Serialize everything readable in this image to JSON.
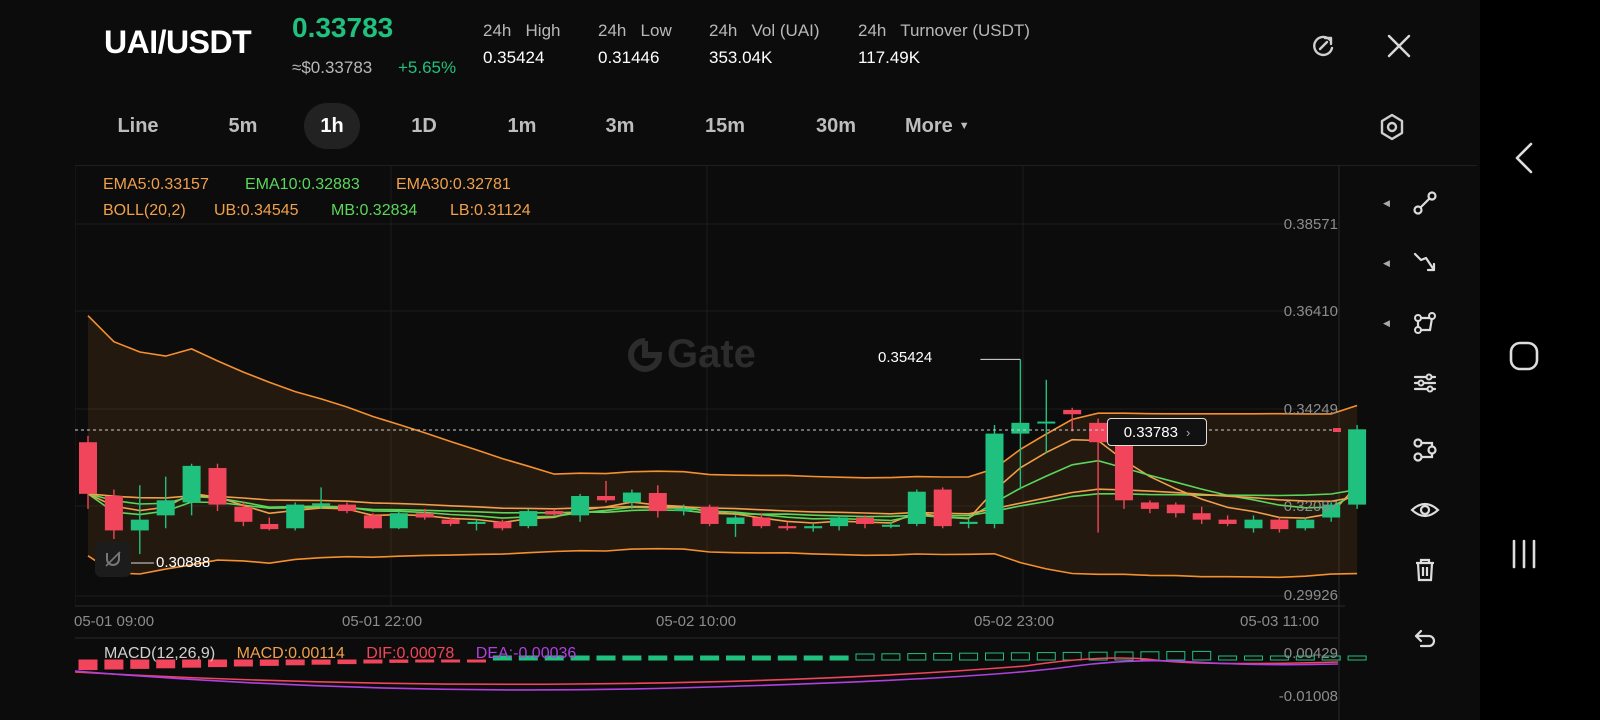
{
  "header": {
    "pair": "UAI/USDT",
    "price": "0.33783",
    "usd_price": "≈$0.33783",
    "change": "+5.65%",
    "stats": [
      {
        "label": "24h   High",
        "value": "0.35424"
      },
      {
        "label": "24h   Low",
        "value": "0.31446"
      },
      {
        "label": "24h   Vol (UAI)",
        "value": "353.04K"
      },
      {
        "label": "24h   Turnover (USDT)",
        "value": "117.49K"
      }
    ]
  },
  "tabs": [
    "Line",
    "5m",
    "1h",
    "1D",
    "1m",
    "3m",
    "15m",
    "30m",
    "More"
  ],
  "active_tab": "1h",
  "legend": {
    "ema5": "EMA5:0.33157",
    "ema10": "EMA10:0.32883",
    "ema30": "EMA30:0.32781",
    "boll": "BOLL(20,2)",
    "ub": "UB:0.34545",
    "mb": "MB:0.32834",
    "lb": "LB:0.31124"
  },
  "y_ticks": [
    "0.38571",
    "0.36410",
    "0.34249",
    "0.32087",
    "0.29926"
  ],
  "x_ticks": [
    "05-01 09:00",
    "05-01 22:00",
    "05-02 10:00",
    "05-02 23:00",
    "05-03 11:00"
  ],
  "annotations": {
    "high_marker": "0.35424",
    "low_marker": "0.30888",
    "current_price": "0.33783"
  },
  "watermark": "Gate",
  "macd": {
    "label": "MACD(12,26,9)",
    "macd": "MACD:0.00114",
    "dif": "DIF:0.00078",
    "dea": "DEA:-0.00036",
    "y_top": "0.00429",
    "y_bottom": "-0.01008"
  },
  "colors": {
    "up": "#20c17e",
    "down": "#f0455b",
    "ema5": "#f0a04b",
    "ema10": "#5bd65b",
    "ema30": "#f0a04b",
    "boll": "#f5902f",
    "dif": "#f0455b",
    "dea": "#b040e0"
  },
  "chart_data": {
    "type": "candlestick",
    "ylim": [
      0.29926,
      0.38571
    ],
    "candles": [
      {
        "o": 0.335,
        "h": 0.3365,
        "l": 0.3195,
        "c": 0.323
      },
      {
        "o": 0.3225,
        "h": 0.324,
        "l": 0.3125,
        "c": 0.3145
      },
      {
        "o": 0.3145,
        "h": 0.325,
        "l": 0.309,
        "c": 0.317
      },
      {
        "o": 0.318,
        "h": 0.327,
        "l": 0.315,
        "c": 0.3215
      },
      {
        "o": 0.321,
        "h": 0.33,
        "l": 0.318,
        "c": 0.3295
      },
      {
        "o": 0.329,
        "h": 0.33,
        "l": 0.319,
        "c": 0.3205
      },
      {
        "o": 0.32,
        "h": 0.321,
        "l": 0.3155,
        "c": 0.3165
      },
      {
        "o": 0.316,
        "h": 0.3175,
        "l": 0.3145,
        "c": 0.3148
      },
      {
        "o": 0.315,
        "h": 0.321,
        "l": 0.3145,
        "c": 0.3205
      },
      {
        "o": 0.3205,
        "h": 0.3245,
        "l": 0.3195,
        "c": 0.3208
      },
      {
        "o": 0.3205,
        "h": 0.321,
        "l": 0.3185,
        "c": 0.319
      },
      {
        "o": 0.318,
        "h": 0.3185,
        "l": 0.3148,
        "c": 0.315
      },
      {
        "o": 0.315,
        "h": 0.319,
        "l": 0.3148,
        "c": 0.3185
      },
      {
        "o": 0.3185,
        "h": 0.3195,
        "l": 0.317,
        "c": 0.3175
      },
      {
        "o": 0.317,
        "h": 0.3175,
        "l": 0.3155,
        "c": 0.316
      },
      {
        "o": 0.316,
        "h": 0.317,
        "l": 0.3145,
        "c": 0.3165
      },
      {
        "o": 0.3165,
        "h": 0.317,
        "l": 0.3145,
        "c": 0.315
      },
      {
        "o": 0.3155,
        "h": 0.3195,
        "l": 0.315,
        "c": 0.319
      },
      {
        "o": 0.319,
        "h": 0.3195,
        "l": 0.318,
        "c": 0.3182
      },
      {
        "o": 0.318,
        "h": 0.323,
        "l": 0.3165,
        "c": 0.3225
      },
      {
        "o": 0.3225,
        "h": 0.326,
        "l": 0.321,
        "c": 0.3215
      },
      {
        "o": 0.321,
        "h": 0.324,
        "l": 0.3195,
        "c": 0.3233
      },
      {
        "o": 0.3232,
        "h": 0.325,
        "l": 0.3175,
        "c": 0.319
      },
      {
        "o": 0.319,
        "h": 0.3205,
        "l": 0.318,
        "c": 0.3195
      },
      {
        "o": 0.32,
        "h": 0.3205,
        "l": 0.3155,
        "c": 0.316
      },
      {
        "o": 0.316,
        "h": 0.318,
        "l": 0.313,
        "c": 0.3175
      },
      {
        "o": 0.3175,
        "h": 0.3185,
        "l": 0.315,
        "c": 0.3155
      },
      {
        "o": 0.3155,
        "h": 0.3165,
        "l": 0.3145,
        "c": 0.315
      },
      {
        "o": 0.315,
        "h": 0.316,
        "l": 0.3142,
        "c": 0.3155
      },
      {
        "o": 0.3155,
        "h": 0.318,
        "l": 0.3145,
        "c": 0.3175
      },
      {
        "o": 0.3175,
        "h": 0.318,
        "l": 0.315,
        "c": 0.316
      },
      {
        "o": 0.3155,
        "h": 0.3165,
        "l": 0.315,
        "c": 0.3158
      },
      {
        "o": 0.316,
        "h": 0.324,
        "l": 0.3155,
        "c": 0.3235
      },
      {
        "o": 0.324,
        "h": 0.3245,
        "l": 0.315,
        "c": 0.3155
      },
      {
        "o": 0.316,
        "h": 0.317,
        "l": 0.315,
        "c": 0.3165
      },
      {
        "o": 0.316,
        "h": 0.339,
        "l": 0.315,
        "c": 0.337
      },
      {
        "o": 0.337,
        "h": 0.3542,
        "l": 0.324,
        "c": 0.3395
      },
      {
        "o": 0.3395,
        "h": 0.3495,
        "l": 0.3325,
        "c": 0.3398
      },
      {
        "o": 0.3425,
        "h": 0.343,
        "l": 0.3375,
        "c": 0.3415
      },
      {
        "o": 0.3395,
        "h": 0.3405,
        "l": 0.314,
        "c": 0.335
      },
      {
        "o": 0.335,
        "h": 0.336,
        "l": 0.3195,
        "c": 0.3215
      },
      {
        "o": 0.321,
        "h": 0.3215,
        "l": 0.3185,
        "c": 0.3195
      },
      {
        "o": 0.3205,
        "h": 0.321,
        "l": 0.3175,
        "c": 0.3185
      },
      {
        "o": 0.3185,
        "h": 0.32,
        "l": 0.316,
        "c": 0.317
      },
      {
        "o": 0.317,
        "h": 0.318,
        "l": 0.3155,
        "c": 0.316
      },
      {
        "o": 0.315,
        "h": 0.318,
        "l": 0.314,
        "c": 0.317
      },
      {
        "o": 0.317,
        "h": 0.3175,
        "l": 0.314,
        "c": 0.3148
      },
      {
        "o": 0.315,
        "h": 0.3175,
        "l": 0.3145,
        "c": 0.317
      },
      {
        "o": 0.3175,
        "h": 0.321,
        "l": 0.3165,
        "c": 0.3205
      },
      {
        "o": 0.3205,
        "h": 0.339,
        "l": 0.3195,
        "c": 0.338
      }
    ]
  }
}
